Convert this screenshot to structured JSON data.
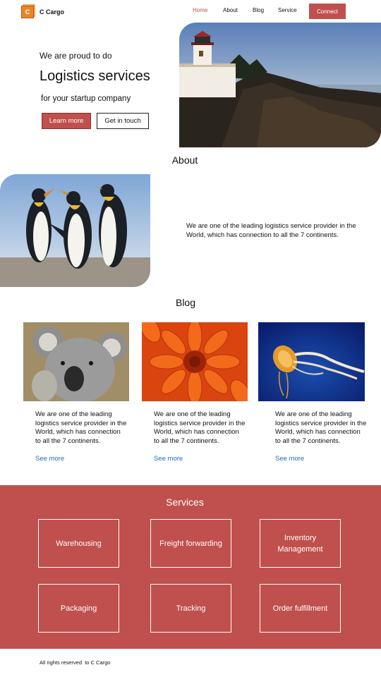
{
  "brand": {
    "logo_letter": "C",
    "name": "C Cargo"
  },
  "nav": {
    "items": [
      "Home",
      "About",
      "Blog",
      "Service"
    ],
    "active": "Home",
    "connect_label": "Connect"
  },
  "hero": {
    "line1": "We are proud to do",
    "title": "Logistics services",
    "line3": "for your startup company",
    "learn_more": "Learn more",
    "get_in_touch": "Get in touch"
  },
  "about": {
    "heading": "About",
    "text": "We are one of the leading logistics service provider in the World, which has connection to all the 7 continents."
  },
  "blog": {
    "heading": "Blog",
    "posts": [
      {
        "text": "We are one of the leading logistics service provider in the World, which has connection to all the 7 continents.",
        "link": "See more"
      },
      {
        "text": "We are one of the leading logistics service provider in the World, which has connection to all the 7 continents.",
        "link": "See more"
      },
      {
        "text": "We are one of the leading logistics service provider in the World, which has connection to all the 7 continents.",
        "link": "See more"
      }
    ]
  },
  "services": {
    "heading": "Services",
    "items": [
      "Warehousing",
      "Freight forwarding",
      "Inventory Management",
      "Packaging",
      "Tracking",
      "Order fulfillment"
    ]
  },
  "footer": {
    "text": "All rights reserved  to C Cargo"
  },
  "colors": {
    "accent": "#c0504d",
    "link": "#1f6db3",
    "logo": "#e8862a"
  }
}
